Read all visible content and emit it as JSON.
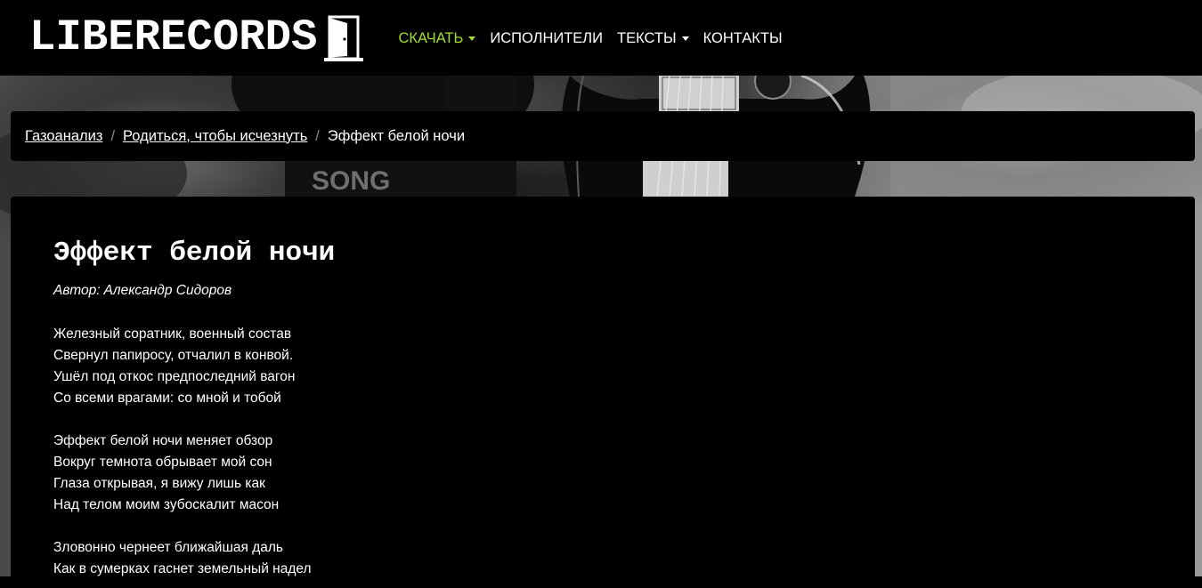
{
  "navbar": {
    "brand": "LIBERECORDS",
    "items": [
      {
        "label": "СКАЧАТЬ",
        "active": true,
        "dropdown": true
      },
      {
        "label": "ИСПОЛНИТЕЛИ",
        "active": false,
        "dropdown": false
      },
      {
        "label": "ТЕКСТЫ",
        "active": false,
        "dropdown": true
      },
      {
        "label": "КОНТАКТЫ",
        "active": false,
        "dropdown": false
      }
    ]
  },
  "breadcrumb": {
    "items": [
      "Газоанализ",
      "Родиться, чтобы исчезнуть"
    ],
    "current": "Эффект белой ночи",
    "separator": "/"
  },
  "song": {
    "title": "Эффект белой ночи",
    "author_label": "Автор:",
    "author": "Александр Сидоров",
    "stanzas": [
      [
        "Железный соратник, военный состав",
        "Свернул папиросу, отчалил в конвой.",
        "Ушёл под откос предпоследний вагон",
        "Со всеми врагами: со мной и тобой"
      ],
      [
        "Эффект белой ночи меняет обзор",
        "Вокруг темнота обрывает мой сон",
        "Глаза открывая, я вижу лишь как",
        "Над телом моим зубоскалит масон"
      ],
      [
        "Зловонно чернеет ближайшая даль",
        "Как в сумерках гаснет земельный надел"
      ]
    ]
  },
  "colors": {
    "accent": "#a2de2c",
    "background": "#000000",
    "text": "#ffffff",
    "separator": "#8a8a8a"
  },
  "icons": {
    "brand": "door-icon",
    "dropdown": "caret-down-icon"
  }
}
